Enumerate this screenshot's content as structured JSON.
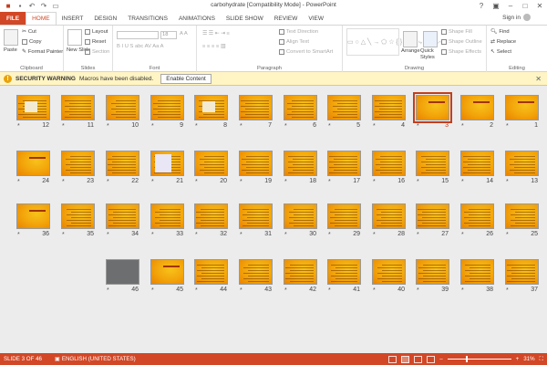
{
  "window": {
    "title": "carbohydrate [Compatibility Mode] - PowerPoint"
  },
  "tabs": [
    "FILE",
    "HOME",
    "INSERT",
    "DESIGN",
    "TRANSITIONS",
    "ANIMATIONS",
    "SLIDE SHOW",
    "REVIEW",
    "VIEW"
  ],
  "account": {
    "signin": "Sign in"
  },
  "ribbon": {
    "clipboard": {
      "label": "Clipboard",
      "paste": "Paste",
      "cut": "Cut",
      "copy": "Copy",
      "format_painter": "Format Painter"
    },
    "slides": {
      "label": "Slides",
      "new_slide": "New Slide",
      "layout": "Layout",
      "reset": "Reset",
      "section": "Section"
    },
    "font": {
      "label": "Font",
      "size": "18"
    },
    "paragraph": {
      "label": "Paragraph",
      "text_direction": "Text Direction",
      "align_text": "Align Text",
      "convert_smartart": "Convert to SmartArt"
    },
    "drawing": {
      "label": "Drawing",
      "arrange": "Arrange",
      "quick_styles": "Quick Styles",
      "shape_fill": "Shape Fill",
      "shape_outline": "Shape Outline",
      "shape_effects": "Shape Effects"
    },
    "editing": {
      "label": "Editing",
      "find": "Find",
      "replace": "Replace",
      "select": "Select"
    }
  },
  "security": {
    "title": "SECURITY WARNING",
    "message": "Macros have been disabled.",
    "button": "Enable Content"
  },
  "slides": {
    "total": 46,
    "selected": 3,
    "star": "*"
  },
  "status": {
    "slide_info": "SLIDE 3 OF 46",
    "language": "ENGLISH (UNITED STATES)",
    "zoom": "31%"
  },
  "colors": {
    "accent": "#d24726",
    "slide_bg": "#f2a30a",
    "warning_bg": "#fff4c4"
  }
}
